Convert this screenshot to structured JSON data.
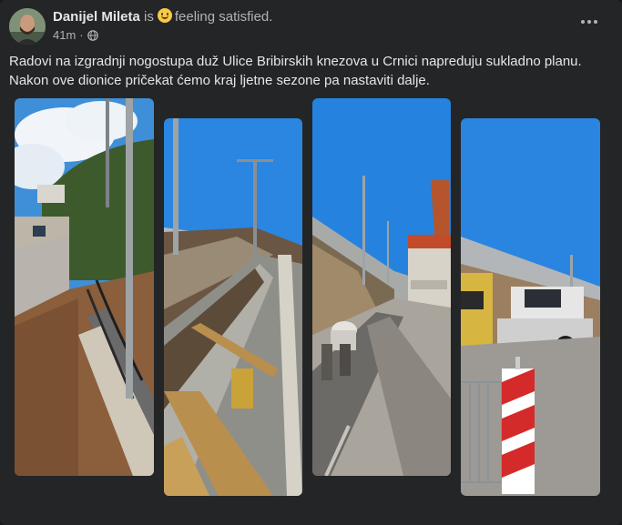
{
  "post": {
    "author": "Danijel Mileta",
    "is_text": "is",
    "feeling_emoji": "slightly-smiling-face",
    "feeling_text": "feeling satisfied.",
    "time": "41m",
    "separator": "·",
    "privacy_icon": "globe-icon",
    "more_icon": "more-horizontal-icon",
    "text_lines": [
      "Radovi na izgradnji nogostupa duž Ulice Bribirskih knezova u Crnici napreduju sukladno planu.",
      "Nakon ove dionice pričekat ćemo kraj ljetne sezone pa nastaviti dalje."
    ]
  },
  "photos": [
    {
      "name": "construction-photo-1"
    },
    {
      "name": "construction-photo-2"
    },
    {
      "name": "construction-photo-3"
    },
    {
      "name": "construction-photo-4"
    }
  ],
  "colors": {
    "background": "#18191a",
    "card": "#242526",
    "primary_text": "#e4e6eb",
    "secondary_text": "#b0b3b8",
    "sky": "#2a7de0"
  }
}
